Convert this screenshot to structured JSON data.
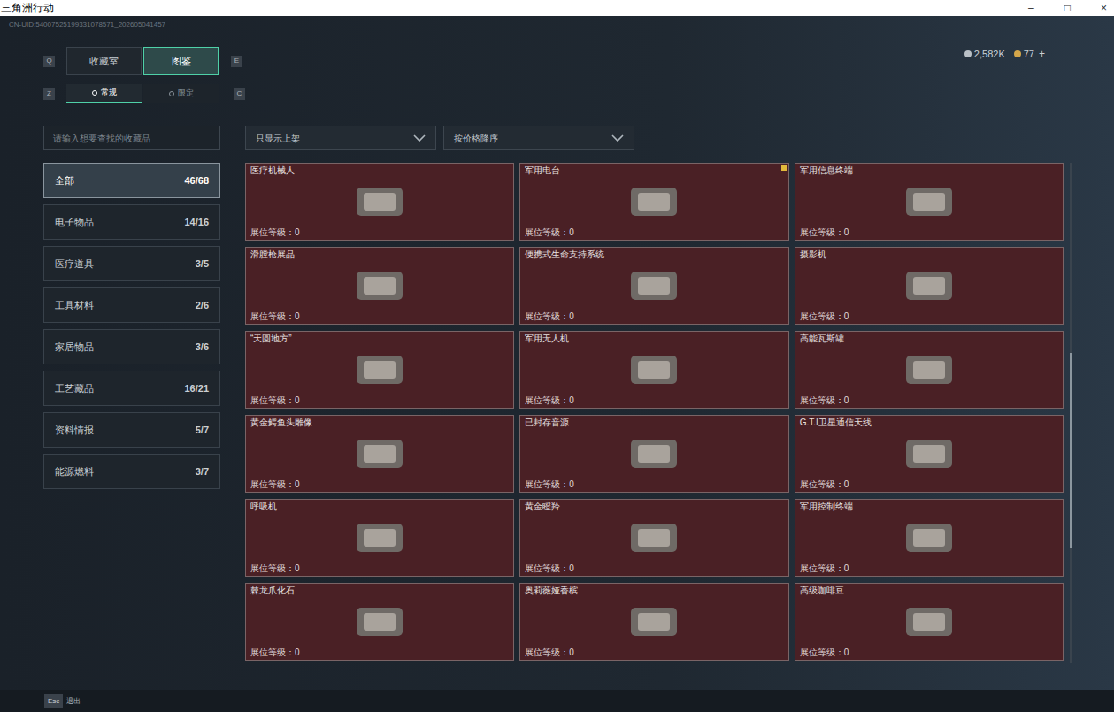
{
  "window": {
    "title": "三角洲行动",
    "controls": [
      "–",
      "□",
      "×"
    ]
  },
  "uid": "CN-UID:54007525199331078571_202605041457",
  "currency": [
    {
      "amount": "2,582K",
      "kind": "silver"
    },
    {
      "amount": "77",
      "kind": "gold"
    }
  ],
  "currency_add": "+",
  "main_tabs": {
    "left_key": "Q",
    "right_key": "E",
    "items": [
      {
        "label": "收藏室",
        "selected": false
      },
      {
        "label": "图鉴",
        "selected": true
      }
    ]
  },
  "sub_tabs": {
    "left_key": "Z",
    "right_key": "C",
    "items": [
      {
        "label": "常规",
        "selected": true
      },
      {
        "label": "限定",
        "selected": false
      }
    ]
  },
  "search": {
    "placeholder": "请输入想要查找的收藏品"
  },
  "filters": [
    {
      "label": "只显示上架"
    },
    {
      "label": "按价格降序"
    }
  ],
  "categories": [
    {
      "label": "全部",
      "count": "46/68",
      "selected": true
    },
    {
      "label": "电子物品",
      "count": "14/16",
      "selected": false
    },
    {
      "label": "医疗道具",
      "count": "3/5",
      "selected": false
    },
    {
      "label": "工具材料",
      "count": "2/6",
      "selected": false
    },
    {
      "label": "家居物品",
      "count": "3/6",
      "selected": false
    },
    {
      "label": "工艺藏品",
      "count": "16/21",
      "selected": false
    },
    {
      "label": "资料情报",
      "count": "5/7",
      "selected": false
    },
    {
      "label": "能源燃料",
      "count": "3/7",
      "selected": false
    }
  ],
  "items": [
    {
      "name": "医疗机械人",
      "level": "展位等级：0",
      "flagged": false
    },
    {
      "name": "军用电台",
      "level": "展位等级：0",
      "flagged": true
    },
    {
      "name": "军用信息终端",
      "level": "展位等级：0",
      "flagged": false
    },
    {
      "name": "滑膛枪展品",
      "level": "展位等级：0",
      "flagged": false
    },
    {
      "name": "便携式生命支持系统",
      "level": "展位等级：0",
      "flagged": false
    },
    {
      "name": "摄影机",
      "level": "展位等级：0",
      "flagged": false
    },
    {
      "name": "“天圆地方”",
      "level": "展位等级：0",
      "flagged": false
    },
    {
      "name": "军用无人机",
      "level": "展位等级：0",
      "flagged": false
    },
    {
      "name": "高能瓦斯罐",
      "level": "展位等级：0",
      "flagged": false
    },
    {
      "name": "黄金鳄鱼头雕像",
      "level": "展位等级：0",
      "flagged": false
    },
    {
      "name": "已封存音源",
      "level": "展位等级：0",
      "flagged": false
    },
    {
      "name": "G.T.I卫星通信天线",
      "level": "展位等级：0",
      "flagged": false
    },
    {
      "name": "呼吸机",
      "level": "展位等级：0",
      "flagged": false
    },
    {
      "name": "黄金瞪羚",
      "level": "展位等级：0",
      "flagged": false
    },
    {
      "name": "军用控制终端",
      "level": "展位等级：0",
      "flagged": false
    },
    {
      "name": "棘龙爪化石",
      "level": "展位等级：0",
      "flagged": false
    },
    {
      "name": "奥莉薇娅香槟",
      "level": "展位等级：0",
      "flagged": false
    },
    {
      "name": "高级咖啡豆",
      "level": "展位等级：0",
      "flagged": false
    }
  ],
  "scrollbar": {
    "offset": 0.38,
    "level": 0.39
  },
  "footer": {
    "key": "Esc",
    "label": "退出"
  }
}
